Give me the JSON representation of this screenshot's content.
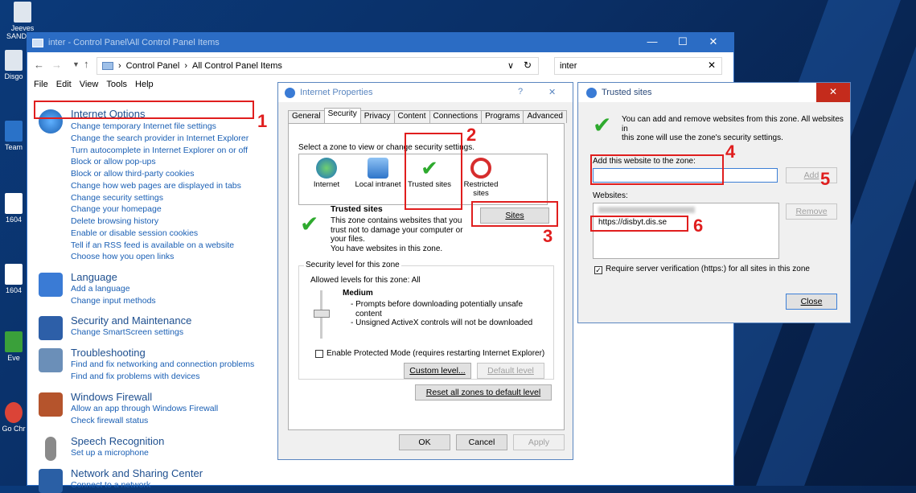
{
  "desktop": {
    "icons": [
      {
        "label": "Jeeves SANDBOX"
      },
      {
        "label": "Disgo"
      },
      {
        "label": "Team"
      },
      {
        "label": "1604"
      },
      {
        "label": "1604"
      },
      {
        "label": "Eve"
      },
      {
        "label": "Go Chr"
      }
    ]
  },
  "control_panel": {
    "title": "inter - Control Panel\\All Control Panel Items",
    "breadcrumb": [
      "Control Panel",
      "All Control Panel Items"
    ],
    "search_value": "inter",
    "menu": [
      "File",
      "Edit",
      "View",
      "Tools",
      "Help"
    ],
    "categories": [
      {
        "title": "Internet Options",
        "links": [
          "Change temporary Internet file settings",
          "Change the search provider in Internet Explorer",
          "Turn autocomplete in Internet Explorer on or off",
          "Block or allow pop-ups",
          "Block or allow third-party cookies",
          "Change how web pages are displayed in tabs",
          "Change security settings",
          "Change your homepage",
          "Delete browsing history",
          "Enable or disable session cookies",
          "Tell if an RSS feed is available on a website",
          "Choose how you open links"
        ]
      },
      {
        "title": "Language",
        "links": [
          "Add a language",
          "Change input methods"
        ]
      },
      {
        "title": "Security and Maintenance",
        "links": [
          "Change SmartScreen settings"
        ]
      },
      {
        "title": "Troubleshooting",
        "links": [
          "Find and fix networking and connection problems",
          "Find and fix problems with devices"
        ]
      },
      {
        "title": "Windows Firewall",
        "links": [
          "Allow an app through Windows Firewall",
          "Check firewall status"
        ]
      },
      {
        "title": "Speech Recognition",
        "links": [
          "Set up a microphone"
        ]
      },
      {
        "title": "Network and Sharing Center",
        "links": [
          "Connect to a network"
        ]
      }
    ]
  },
  "internet_properties": {
    "title": "Internet Properties",
    "tabs": [
      "General",
      "Security",
      "Privacy",
      "Content",
      "Connections",
      "Programs",
      "Advanced"
    ],
    "zone_prompt": "Select a zone to view or change security settings.",
    "zones": [
      "Internet",
      "Local intranet",
      "Trusted sites",
      "Restricted sites"
    ],
    "zone_heading": "Trusted sites",
    "zone_desc": [
      "This zone contains websites that you",
      "trust not to damage your computer or",
      "your files.",
      "You have websites in this zone."
    ],
    "sites_button": "Sites",
    "security_level_label": "Security level for this zone",
    "allowed_levels": "Allowed levels for this zone: All",
    "level_name": "Medium",
    "level_bullets": [
      "- Prompts before downloading potentially unsafe",
      "content",
      "- Unsigned ActiveX controls will not be downloaded"
    ],
    "protected_mode": "Enable Protected Mode (requires restarting Internet Explorer)",
    "custom_level": "Custom level...",
    "default_level": "Default level",
    "reset_all": "Reset all zones to default level",
    "ok": "OK",
    "cancel": "Cancel",
    "apply": "Apply"
  },
  "trusted_sites": {
    "title": "Trusted sites",
    "info": [
      "You can add and remove websites from this zone. All websites in",
      "this zone will use the zone's security settings."
    ],
    "add_label": "Add this website to the zone:",
    "add_value": "",
    "add_button": "Add",
    "websites_label": "Websites:",
    "websites": [
      "https://disbyt.dis.se"
    ],
    "remove_button": "Remove",
    "require_https": "Require server verification (https:) for all sites in this zone",
    "close_button": "Close"
  },
  "annotations": [
    "1",
    "2",
    "3",
    "4",
    "5",
    "6"
  ]
}
